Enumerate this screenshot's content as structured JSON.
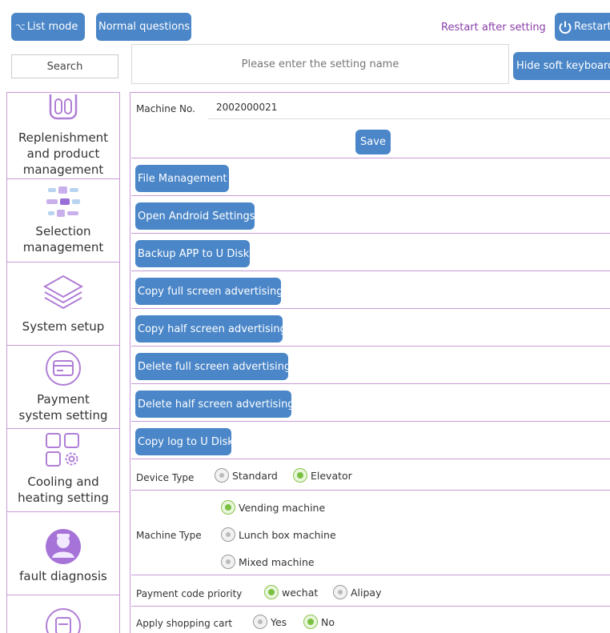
{
  "topbar": {
    "list_mode": "List mode",
    "normal_questions": "Normal questions",
    "restart_after_setting": "Restart after setting",
    "restart": "Restart",
    "search": "Search",
    "setting_name_placeholder": "Please enter the setting name",
    "hide_keyboard": "Hide soft keyboard"
  },
  "sidebar": {
    "items": [
      {
        "label": "Replenishment and product management",
        "icon": "phone-icon"
      },
      {
        "label": "Selection management",
        "icon": "selection-grid-icon"
      },
      {
        "label": "System setup",
        "icon": "layers-icon"
      },
      {
        "label": "Payment system setting",
        "icon": "card-icon"
      },
      {
        "label": "Cooling and heating setting",
        "icon": "squares-gear-icon"
      },
      {
        "label": "fault diagnosis",
        "icon": "person-icon"
      },
      {
        "label": "",
        "icon": "box-icon"
      }
    ]
  },
  "machine": {
    "label": "Machine No.",
    "value": "2002000021",
    "save": "Save"
  },
  "actions": [
    "File Management",
    "Open Android Settings",
    "Backup APP to U Disk",
    "Copy full screen advertising",
    "Copy half screen advertising",
    "Delete full screen advertising",
    "Delete half screen advertising",
    "Copy log to U Disk"
  ],
  "device_type": {
    "label": "Device Type",
    "options": [
      {
        "label": "Standard",
        "selected": false
      },
      {
        "label": "Elevator",
        "selected": true
      }
    ]
  },
  "machine_type": {
    "label": "Machine Type",
    "options": [
      {
        "label": "Vending machine",
        "selected": true
      },
      {
        "label": "Lunch box machine",
        "selected": false
      },
      {
        "label": "Mixed machine",
        "selected": false
      }
    ]
  },
  "payment_priority": {
    "label": "Payment code priority",
    "options": [
      {
        "label": "wechat",
        "selected": true
      },
      {
        "label": "Alipay",
        "selected": false
      }
    ]
  },
  "shopping_cart": {
    "label": "Apply shopping cart",
    "options": [
      {
        "label": "Yes",
        "selected": false
      },
      {
        "label": "No",
        "selected": true
      }
    ]
  },
  "colors": {
    "button": "#4a86c8",
    "divider": "#c79ad6",
    "icon_purple": "#b07ed6",
    "restart_text": "#8a3fa8",
    "radio_selected": "#7ac142"
  }
}
